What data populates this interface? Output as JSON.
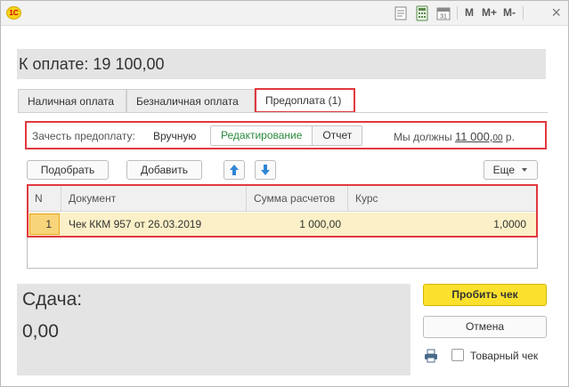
{
  "titlebar": {
    "logo_text": "1C",
    "m_label": "M",
    "m_plus_label": "M+",
    "m_minus_label": "M-",
    "close_glyph": "×",
    "calendar_day": "31"
  },
  "amount": {
    "text": "К оплате: 19 100,00"
  },
  "tabs": [
    {
      "label": "Наличная оплата"
    },
    {
      "label": "Безналичная оплата"
    },
    {
      "label": "Предоплата (1)"
    }
  ],
  "prepay": {
    "label": "Зачесть предоплату:",
    "manual": "Вручную",
    "seg_edit": "Редактирование",
    "seg_report": "Отчет",
    "we_owe_prefix": "Мы должны",
    "we_owe_amount": "11 000,",
    "we_owe_kop": "00",
    "we_owe_suffix": "р."
  },
  "toolbar": {
    "pick": "Подобрать",
    "add": "Добавить",
    "up_glyph": "🡅",
    "down_glyph": "🡇",
    "more": "Еще"
  },
  "table": {
    "columns": [
      "N",
      "Документ",
      "Сумма расчетов",
      "Курс"
    ],
    "rows": [
      {
        "n": "1",
        "doc": "Чек ККМ 957 от 26.03.2019",
        "sum": "1 000,00",
        "rate": "1,0000"
      }
    ]
  },
  "change": {
    "label": "Сдача:",
    "value": "0,00"
  },
  "actions": {
    "print_check": "Пробить чек",
    "cancel": "Отмена",
    "goods_check": "Товарный чек"
  },
  "colors": {
    "highlight_red": "#e0393f",
    "primary_yellow": "#fbe12d",
    "active_green": "#2a8a3c",
    "row_selected": "#fbf0c7",
    "arrow_blue": "#2f86d6"
  }
}
